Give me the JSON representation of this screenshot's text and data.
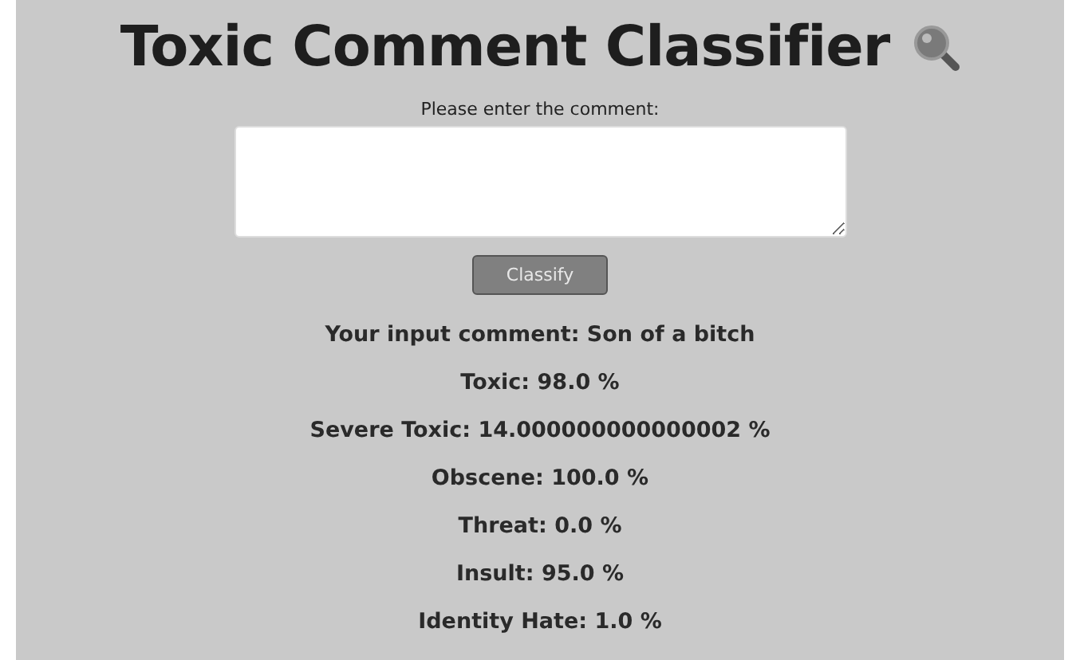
{
  "title": "Toxic Comment Classifier",
  "prompt": "Please enter the comment:",
  "button": "Classify",
  "input_echo": "Your input comment: Son of a bitch",
  "results": [
    "Toxic: 98.0 %",
    "Severe Toxic: 14.000000000000002 %",
    "Obscene: 100.0 %",
    "Threat: 0.0 %",
    "Insult: 95.0 %",
    "Identity Hate: 1.0 %"
  ]
}
